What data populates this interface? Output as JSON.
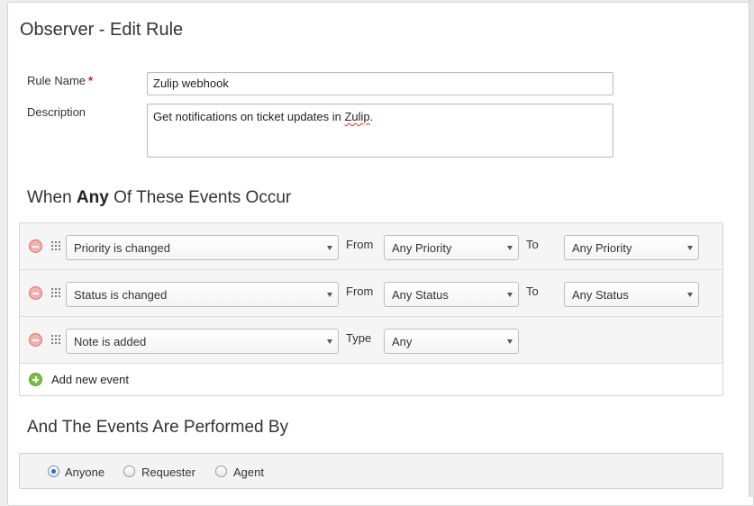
{
  "page": {
    "title": "Observer - Edit Rule"
  },
  "form": {
    "rule_name_label": "Rule Name",
    "required_mark": "*",
    "rule_name_value": "Zulip webhook",
    "description_label": "Description",
    "description_prefix": "Get notifications on ticket updates in ",
    "description_flagged_word": "Zulip",
    "description_suffix": "."
  },
  "events_section": {
    "title_prefix": "When ",
    "title_emphasis": "Any",
    "title_suffix": " Of These Events Occur",
    "rows": [
      {
        "event": "Priority is changed",
        "label_1": "From",
        "value_1": "Any Priority",
        "label_2": "To",
        "value_2": "Any Priority"
      },
      {
        "event": "Status is changed",
        "label_1": "From",
        "value_1": "Any Status",
        "label_2": "To",
        "value_2": "Any Status"
      },
      {
        "event": "Note is added",
        "label_1": "Type",
        "value_1": "Any"
      }
    ],
    "add_event_label": "Add new event"
  },
  "performer_section": {
    "title": "And The Events Are Performed By",
    "options": [
      "Anyone",
      "Requester",
      "Agent"
    ],
    "selected": "Anyone"
  },
  "colors": {
    "required": "#c0222a",
    "remove_icon": "#f3b0ad",
    "add_icon": "#7dbf45",
    "radio_selected": "#2a6bd1"
  },
  "icons": {
    "remove": "remove-event-icon",
    "drag": "drag-handle-icon",
    "add": "add-event-icon",
    "dropdown": "chevron-down-icon"
  }
}
